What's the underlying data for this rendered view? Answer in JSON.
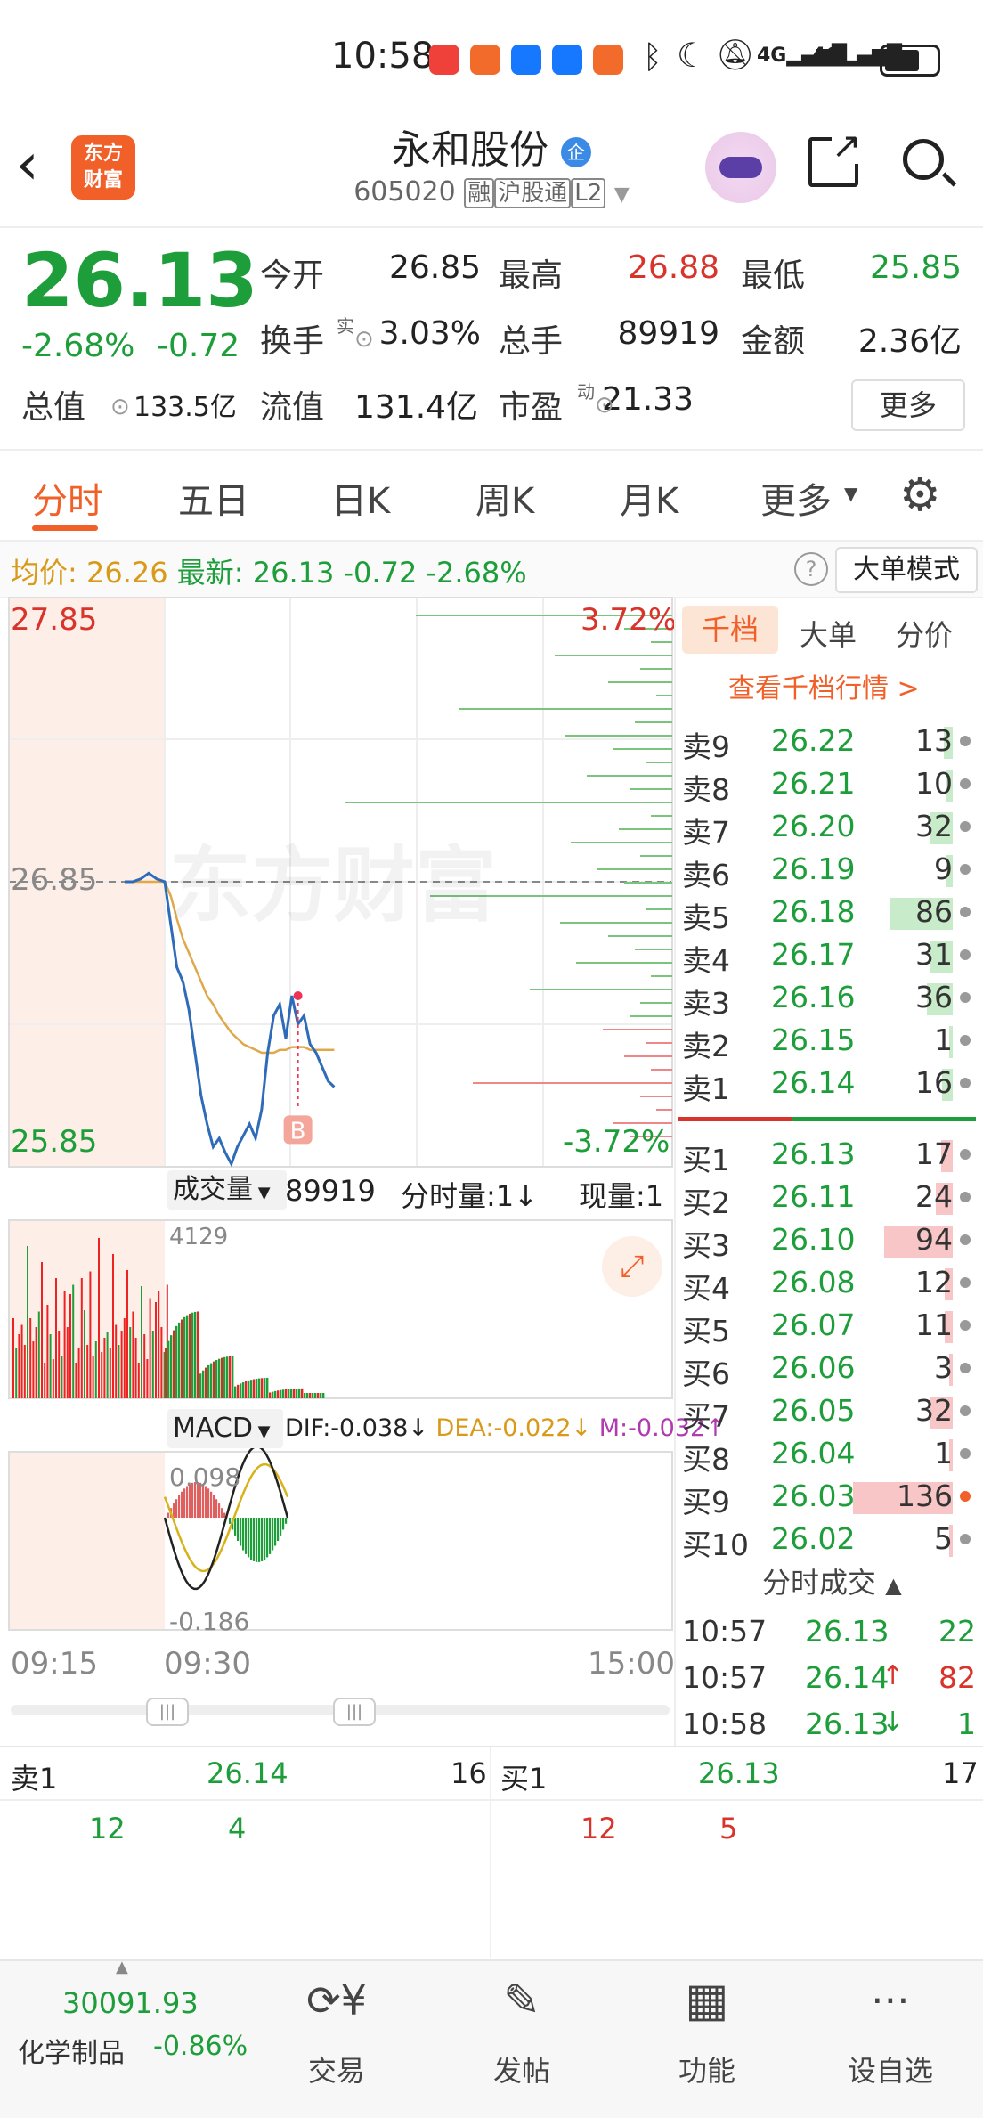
{
  "status_bar": {
    "time": "10:58"
  },
  "header": {
    "logo_text": "东方财富",
    "stock_name": "永和股份",
    "stock_code": "605020",
    "tags": [
      "融",
      "沪股通",
      "L2"
    ]
  },
  "quote": {
    "price": "26.13",
    "change_pct": "-2.68%",
    "change": "-0.72",
    "rows": [
      [
        {
          "label": "今开",
          "value": "26.85",
          "color": "#222"
        },
        {
          "label": "最高",
          "value": "26.88",
          "color": "#d9342b"
        },
        {
          "label": "最低",
          "value": "25.85",
          "color": "#1e9e3a"
        }
      ],
      [
        {
          "label": "换手",
          "value": "3.03%",
          "color": "#222"
        },
        {
          "label": "总手",
          "value": "89919",
          "color": "#222"
        },
        {
          "label": "金额",
          "value": "2.36亿",
          "color": "#222"
        }
      ],
      [
        {
          "label": "总值",
          "value": "133.5亿",
          "color": "#222"
        },
        {
          "label": "流值",
          "value": "131.4亿",
          "color": "#222"
        },
        {
          "label": "市盈",
          "value": "21.33",
          "color": "#222"
        }
      ]
    ],
    "turnover_superscript": "实",
    "pe_superscript": "动",
    "more_button": "更多"
  },
  "tabs": [
    "分时",
    "五日",
    "日K",
    "周K",
    "月K",
    "更多"
  ],
  "info_bar": {
    "avg_label": "均价:",
    "avg_value": "26.26",
    "latest_label": "最新:",
    "latest_value": "26.13",
    "latest_change": "-0.72",
    "latest_pct": "-2.68%",
    "mode_button": "大单模式"
  },
  "chart": {
    "price_high": "27.85",
    "price_ref": "26.85",
    "price_low": "25.85",
    "pct_high": "3.72%",
    "pct_low": "-3.72%",
    "watermark": "东方财富",
    "buy_marker": "B",
    "volume_selector": "成交量",
    "volume_total": "89919",
    "tick_volume_label": "分时量:1↓",
    "current_volume_label": "现量:1",
    "volume_max": "4129",
    "macd_selector": "MACD",
    "dif": "DIF:-0.038↓",
    "dea": "DEA:-0.022↓",
    "m": "M:-0.032↑",
    "macd_high": "0.098",
    "macd_low": "-0.186",
    "time_labels": [
      "09:15",
      "09:30",
      "15:00"
    ]
  },
  "chart_data": {
    "type": "line",
    "x": [
      "09:15",
      "09:18",
      "09:21",
      "09:24",
      "09:27",
      "09:30",
      "09:31",
      "09:32",
      "09:33",
      "09:34",
      "09:35",
      "09:36",
      "09:37",
      "09:38",
      "09:39",
      "09:40",
      "09:41",
      "09:42",
      "09:43",
      "09:44",
      "09:45",
      "09:46",
      "09:47",
      "09:48",
      "09:49",
      "09:50",
      "09:51",
      "09:52",
      "09:53",
      "09:54",
      "09:55",
      "09:56",
      "09:57",
      "09:58"
    ],
    "series": [
      {
        "name": "",
        "values": [
          26.85,
          26.85,
          26.86,
          26.88,
          26.86,
          26.85,
          26.7,
          26.55,
          26.5,
          26.4,
          26.25,
          26.1,
          26.0,
          25.92,
          25.95,
          25.9,
          25.86,
          25.92,
          25.96,
          26.0,
          25.95,
          26.05,
          26.25,
          26.38,
          26.42,
          26.3,
          26.45,
          26.35,
          26.38,
          26.28,
          26.25,
          26.2,
          26.15,
          26.13
        ]
      },
      {
        "name": "均价",
        "values": [
          26.85,
          26.85,
          26.85,
          26.85,
          26.85,
          26.85,
          26.8,
          26.72,
          26.65,
          26.6,
          26.55,
          26.5,
          26.45,
          26.42,
          26.38,
          26.35,
          26.32,
          26.3,
          26.28,
          26.27,
          26.26,
          26.25,
          26.25,
          26.25,
          26.26,
          26.26,
          26.27,
          26.27,
          26.27,
          26.26,
          26.26,
          26.26,
          26.26,
          26.26
        ]
      }
    ],
    "ylim": [
      25.85,
      27.85
    ],
    "y_ticks": [
      "27.85",
      "26.85",
      "25.85"
    ],
    "xlabel": "",
    "ylabel": "",
    "grid": true
  },
  "order_book": {
    "tabs": [
      "千档",
      "大单",
      "分价"
    ],
    "link": "查看千档行情 >",
    "asks": [
      {
        "label": "卖9",
        "price": "26.22",
        "vol": "13",
        "bar": 0.09
      },
      {
        "label": "卖8",
        "price": "26.21",
        "vol": "10",
        "bar": 0.07
      },
      {
        "label": "卖7",
        "price": "26.20",
        "vol": "32",
        "bar": 0.23
      },
      {
        "label": "卖6",
        "price": "26.19",
        "vol": "9",
        "bar": 0.06
      },
      {
        "label": "卖5",
        "price": "26.18",
        "vol": "86",
        "bar": 0.63
      },
      {
        "label": "卖4",
        "price": "26.17",
        "vol": "31",
        "bar": 0.22
      },
      {
        "label": "卖3",
        "price": "26.16",
        "vol": "36",
        "bar": 0.26
      },
      {
        "label": "卖2",
        "price": "26.15",
        "vol": "1",
        "bar": 0.01
      },
      {
        "label": "卖1",
        "price": "26.14",
        "vol": "16",
        "bar": 0.11
      }
    ],
    "bids": [
      {
        "label": "买1",
        "price": "26.13",
        "vol": "17",
        "bar": 0.12
      },
      {
        "label": "买2",
        "price": "26.11",
        "vol": "24",
        "bar": 0.17
      },
      {
        "label": "买3",
        "price": "26.10",
        "vol": "94",
        "bar": 0.69
      },
      {
        "label": "买4",
        "price": "26.08",
        "vol": "12",
        "bar": 0.08
      },
      {
        "label": "买5",
        "price": "26.07",
        "vol": "11",
        "bar": 0.08
      },
      {
        "label": "买6",
        "price": "26.06",
        "vol": "3",
        "bar": 0.02
      },
      {
        "label": "买7",
        "price": "26.05",
        "vol": "32",
        "bar": 0.23
      },
      {
        "label": "买8",
        "price": "26.04",
        "vol": "1",
        "bar": 0.01
      },
      {
        "label": "买9",
        "price": "26.03",
        "vol": "136",
        "bar": 1.0
      },
      {
        "label": "买10",
        "price": "26.02",
        "vol": "5",
        "bar": 0.03
      }
    ],
    "trades_header": "分时成交",
    "trades": [
      {
        "time": "10:57",
        "price": "26.13",
        "vol": "22",
        "arrow": ""
      },
      {
        "time": "10:57",
        "price": "26.14",
        "vol": "82",
        "arrow": "↑"
      },
      {
        "time": "10:58",
        "price": "26.13",
        "vol": "1",
        "arrow": "↓"
      }
    ]
  },
  "bottom_quote": {
    "ask_label": "卖1",
    "ask_price": "26.14",
    "ask_vol": "16",
    "ask_queue": [
      "12",
      "4"
    ],
    "bid_label": "买1",
    "bid_price": "26.13",
    "bid_vol": "17",
    "bid_queue": [
      "12",
      "5"
    ]
  },
  "bottom_nav": {
    "index_value": "30091.93",
    "index_name": "化学制品",
    "index_change": "-0.86%",
    "items": [
      "交易",
      "发帖",
      "功能",
      "设自选"
    ]
  },
  "colors": {
    "red": "#d9342b",
    "green": "#1e9e3a",
    "orange": "#f2602a",
    "gold": "#d89a18",
    "purple": "#b03ab0"
  }
}
